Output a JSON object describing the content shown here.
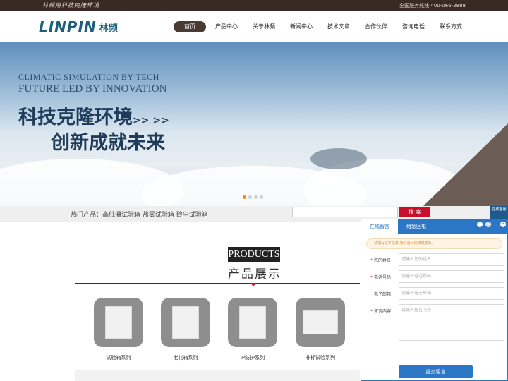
{
  "topbar": {
    "slogan": "林频用科技克隆环境",
    "hotline": "全国服务热线  400-066-2888"
  },
  "header": {
    "logo_en": "LINPIN",
    "logo_cn": "林频",
    "nav": [
      "首页",
      "产品中心",
      "关于林频",
      "新闻中心",
      "技术文章",
      "合作伙伴",
      "咨询电话",
      "联系方式"
    ]
  },
  "banner": {
    "en_line1": "CLIMATIC SIMULATION BY TECH",
    "en_line2": "FUTURE LED BY INNOVATION",
    "cn_line1": "科技克隆环境",
    "cn_line2": "创新成就未来",
    "arrows": ">> >>"
  },
  "hotbar": {
    "text": "热门产品：高低温试验箱 盐雾试验箱 砂尘试验箱",
    "search_button": "搜 索",
    "side_tab": "在线客服"
  },
  "products": {
    "title_en": "PRODUCTS",
    "title_cn": "产品展示",
    "items": [
      "试验箱系列",
      "老化箱系列",
      "IP防护系列",
      "非标试验系列"
    ]
  },
  "chat": {
    "tab_active": "在线留言",
    "tab_second": "给您回电",
    "notice": "请填写以下信息,我们会尽快和您联系。",
    "fields": [
      {
        "label": "您的姓名：",
        "placeholder": "请输入您的姓名",
        "required": true
      },
      {
        "label": "电话号码：",
        "placeholder": "请输入电话号码",
        "required": true
      },
      {
        "label": "电子邮箱：",
        "placeholder": "请输入电子邮箱",
        "required": false
      },
      {
        "label": "留言内容：",
        "placeholder": "请输入留言内容",
        "required": true
      }
    ],
    "submit": "提交留言"
  },
  "colors": {
    "topbar": "#3a2a24",
    "nav_active": "#4a3a32",
    "search_button": "#c8102e",
    "chat_blue": "#2b77c5",
    "dot_active": "#e98a18"
  }
}
